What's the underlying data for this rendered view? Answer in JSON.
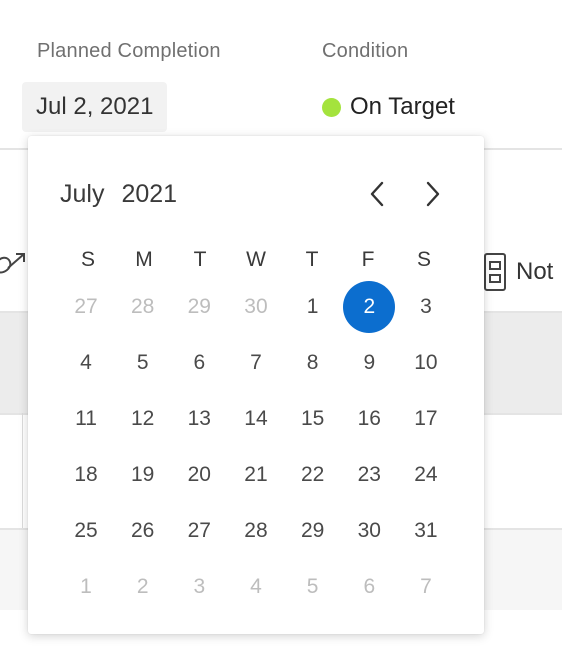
{
  "fields": {
    "planned_completion_label": "Planned Completion",
    "planned_completion_value": "Jul 2, 2021",
    "condition_label": "Condition",
    "condition_value": "On Target",
    "condition_color": "#a4e33d"
  },
  "tabs": {
    "notes_label": "Not"
  },
  "calendar": {
    "month": "July",
    "year": "2021",
    "weekdays": [
      "S",
      "M",
      "T",
      "W",
      "T",
      "F",
      "S"
    ],
    "weeks": [
      [
        {
          "d": "27",
          "out": true
        },
        {
          "d": "28",
          "out": true
        },
        {
          "d": "29",
          "out": true
        },
        {
          "d": "30",
          "out": true
        },
        {
          "d": "1"
        },
        {
          "d": "2",
          "selected": true
        },
        {
          "d": "3"
        }
      ],
      [
        {
          "d": "4"
        },
        {
          "d": "5"
        },
        {
          "d": "6"
        },
        {
          "d": "7"
        },
        {
          "d": "8"
        },
        {
          "d": "9"
        },
        {
          "d": "10"
        }
      ],
      [
        {
          "d": "11"
        },
        {
          "d": "12"
        },
        {
          "d": "13"
        },
        {
          "d": "14"
        },
        {
          "d": "15"
        },
        {
          "d": "16"
        },
        {
          "d": "17"
        }
      ],
      [
        {
          "d": "18"
        },
        {
          "d": "19"
        },
        {
          "d": "20"
        },
        {
          "d": "21"
        },
        {
          "d": "22"
        },
        {
          "d": "23"
        },
        {
          "d": "24"
        }
      ],
      [
        {
          "d": "25"
        },
        {
          "d": "26"
        },
        {
          "d": "27"
        },
        {
          "d": "28"
        },
        {
          "d": "29"
        },
        {
          "d": "30"
        },
        {
          "d": "31"
        }
      ],
      [
        {
          "d": "1",
          "out": true
        },
        {
          "d": "2",
          "out": true
        },
        {
          "d": "3",
          "out": true
        },
        {
          "d": "4",
          "out": true
        },
        {
          "d": "5",
          "out": true
        },
        {
          "d": "6",
          "out": true
        },
        {
          "d": "7",
          "out": true
        }
      ]
    ],
    "accent_color": "#0c6ecf",
    "icons": {
      "prev": "chevron-left-icon",
      "next": "chevron-right-icon"
    }
  }
}
